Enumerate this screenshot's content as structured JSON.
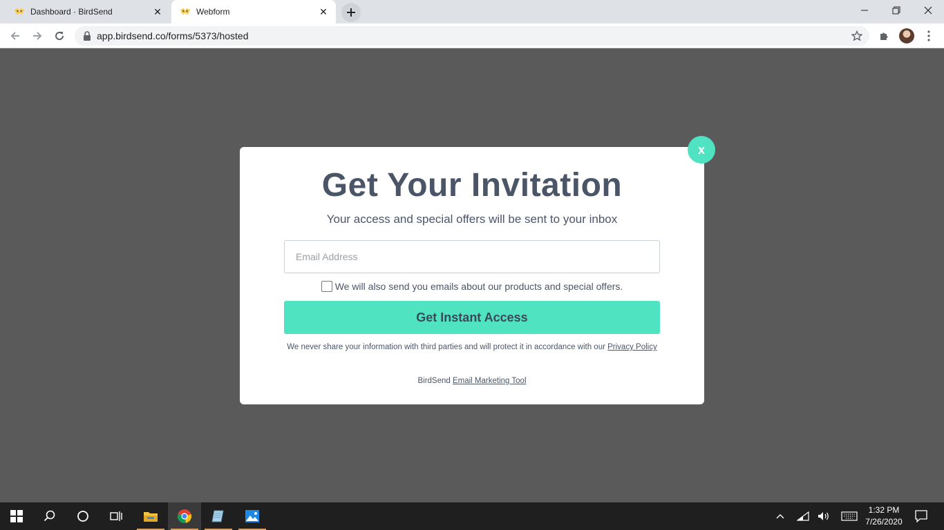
{
  "browser": {
    "tabs": [
      {
        "label": "Dashboard · BirdSend",
        "active": false
      },
      {
        "label": "Webform",
        "active": true
      }
    ],
    "url": "app.birdsend.co/forms/5373/hosted"
  },
  "modal": {
    "close_label": "x",
    "title": "Get Your Invitation",
    "subtitle": "Your access and special offers will be sent to your inbox",
    "email_placeholder": "Email Address",
    "email_value": "",
    "consent_label": "We will also send you emails about our products and special offers.",
    "consent_checked": false,
    "cta_label": "Get Instant Access",
    "privacy_text": "We never share your information with third parties and will protect it in accordance with our",
    "privacy_link": "Privacy Policy",
    "brand_text": "BirdSend",
    "brand_link": "Email Marketing Tool"
  },
  "taskbar": {
    "time": "1:32 PM",
    "date": "7/26/2020"
  },
  "colors": {
    "accent": "#50e3c2",
    "backdrop": "#5a5a5a",
    "text": "#4a5568"
  }
}
